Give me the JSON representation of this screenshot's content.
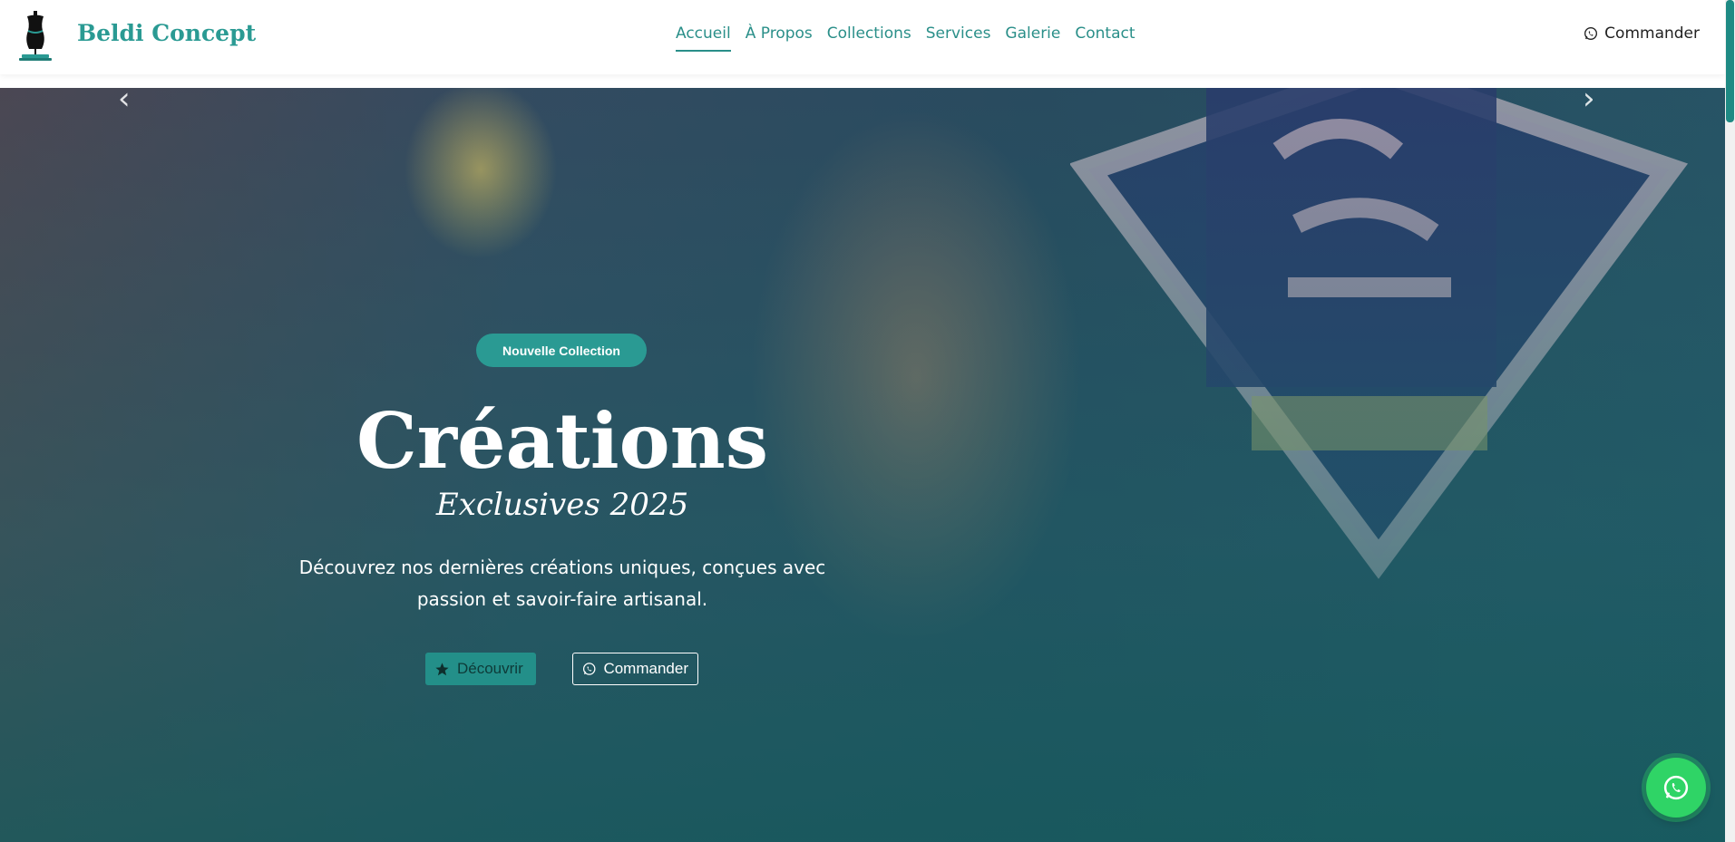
{
  "brand": {
    "name": "Beldi Concept",
    "logo_icon": "dress-form-icon"
  },
  "nav": {
    "items": [
      {
        "label": "Accueil",
        "active": true
      },
      {
        "label": "À Propos"
      },
      {
        "label": "Collections"
      },
      {
        "label": "Services"
      },
      {
        "label": "Galerie"
      },
      {
        "label": "Contact"
      }
    ]
  },
  "header_cta": {
    "label": "Commander",
    "icon": "whatsapp-icon"
  },
  "hero": {
    "badge": "Nouvelle Collection",
    "title": "Créations",
    "subtitle": "Exclusives 2025",
    "description": "Découvrez nos dernières créations uniques, conçues avec passion et savoir-faire artisanal.",
    "primary_button": {
      "label": "Découvrir",
      "icon": "star-icon"
    },
    "secondary_button": {
      "label": "Commander",
      "icon": "whatsapp-icon"
    },
    "prev_icon": "chevron-left-icon",
    "next_icon": "chevron-right-icon"
  },
  "floating_button": {
    "icon": "whatsapp-icon"
  },
  "colors": {
    "brand": "#2a9a93",
    "accent": "#238f89",
    "whatsapp": "#2fd466"
  }
}
